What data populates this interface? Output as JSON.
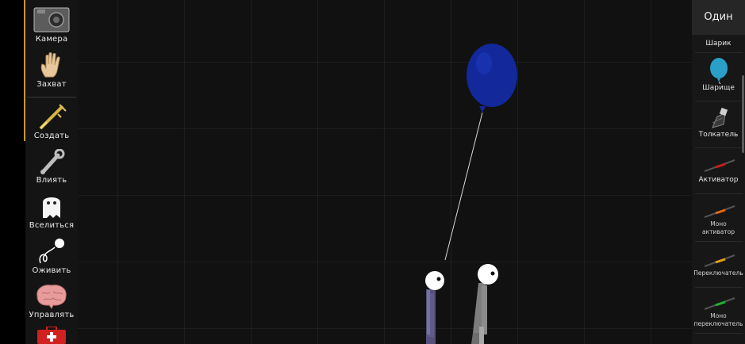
{
  "left_toolbar": {
    "camera": "Камера",
    "grab": "Захват",
    "create": "Создать",
    "affect": "Влиять",
    "possess": "Вселиться",
    "revive": "Оживить",
    "control": "Управлять"
  },
  "right_panel": {
    "mode_button": "Один",
    "items": [
      {
        "label": "Шарик"
      },
      {
        "label": "Шарище"
      },
      {
        "label": "Толкатель"
      },
      {
        "label": "Активатор"
      },
      {
        "label1": "Моно",
        "label2": "активатор"
      },
      {
        "label": "Переключатель"
      },
      {
        "label1": "Моно",
        "label2": "переключатель"
      }
    ]
  },
  "colors": {
    "accent": "#c8962a",
    "balloon": "#13289a",
    "background": "#111111"
  }
}
